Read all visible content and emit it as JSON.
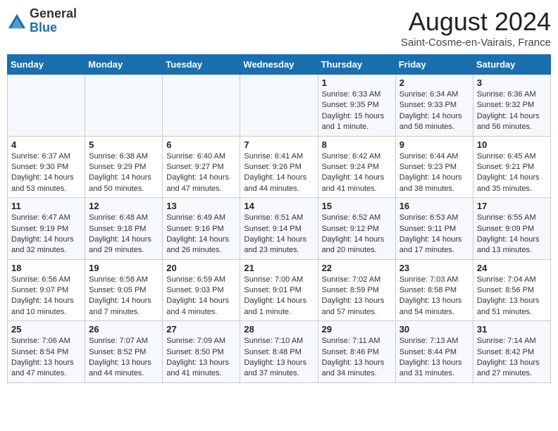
{
  "header": {
    "logo_general": "General",
    "logo_blue": "Blue",
    "month_year": "August 2024",
    "location": "Saint-Cosme-en-Vairais, France"
  },
  "days_of_week": [
    "Sunday",
    "Monday",
    "Tuesday",
    "Wednesday",
    "Thursday",
    "Friday",
    "Saturday"
  ],
  "weeks": [
    [
      {
        "num": "",
        "info": ""
      },
      {
        "num": "",
        "info": ""
      },
      {
        "num": "",
        "info": ""
      },
      {
        "num": "",
        "info": ""
      },
      {
        "num": "1",
        "info": "Sunrise: 6:33 AM\nSunset: 9:35 PM\nDaylight: 15 hours and 1 minute."
      },
      {
        "num": "2",
        "info": "Sunrise: 6:34 AM\nSunset: 9:33 PM\nDaylight: 14 hours and 58 minutes."
      },
      {
        "num": "3",
        "info": "Sunrise: 6:36 AM\nSunset: 9:32 PM\nDaylight: 14 hours and 56 minutes."
      }
    ],
    [
      {
        "num": "4",
        "info": "Sunrise: 6:37 AM\nSunset: 9:30 PM\nDaylight: 14 hours and 53 minutes."
      },
      {
        "num": "5",
        "info": "Sunrise: 6:38 AM\nSunset: 9:29 PM\nDaylight: 14 hours and 50 minutes."
      },
      {
        "num": "6",
        "info": "Sunrise: 6:40 AM\nSunset: 9:27 PM\nDaylight: 14 hours and 47 minutes."
      },
      {
        "num": "7",
        "info": "Sunrise: 6:41 AM\nSunset: 9:26 PM\nDaylight: 14 hours and 44 minutes."
      },
      {
        "num": "8",
        "info": "Sunrise: 6:42 AM\nSunset: 9:24 PM\nDaylight: 14 hours and 41 minutes."
      },
      {
        "num": "9",
        "info": "Sunrise: 6:44 AM\nSunset: 9:23 PM\nDaylight: 14 hours and 38 minutes."
      },
      {
        "num": "10",
        "info": "Sunrise: 6:45 AM\nSunset: 9:21 PM\nDaylight: 14 hours and 35 minutes."
      }
    ],
    [
      {
        "num": "11",
        "info": "Sunrise: 6:47 AM\nSunset: 9:19 PM\nDaylight: 14 hours and 32 minutes."
      },
      {
        "num": "12",
        "info": "Sunrise: 6:48 AM\nSunset: 9:18 PM\nDaylight: 14 hours and 29 minutes."
      },
      {
        "num": "13",
        "info": "Sunrise: 6:49 AM\nSunset: 9:16 PM\nDaylight: 14 hours and 26 minutes."
      },
      {
        "num": "14",
        "info": "Sunrise: 6:51 AM\nSunset: 9:14 PM\nDaylight: 14 hours and 23 minutes."
      },
      {
        "num": "15",
        "info": "Sunrise: 6:52 AM\nSunset: 9:12 PM\nDaylight: 14 hours and 20 minutes."
      },
      {
        "num": "16",
        "info": "Sunrise: 6:53 AM\nSunset: 9:11 PM\nDaylight: 14 hours and 17 minutes."
      },
      {
        "num": "17",
        "info": "Sunrise: 6:55 AM\nSunset: 9:09 PM\nDaylight: 14 hours and 13 minutes."
      }
    ],
    [
      {
        "num": "18",
        "info": "Sunrise: 6:56 AM\nSunset: 9:07 PM\nDaylight: 14 hours and 10 minutes."
      },
      {
        "num": "19",
        "info": "Sunrise: 6:58 AM\nSunset: 9:05 PM\nDaylight: 14 hours and 7 minutes."
      },
      {
        "num": "20",
        "info": "Sunrise: 6:59 AM\nSunset: 9:03 PM\nDaylight: 14 hours and 4 minutes."
      },
      {
        "num": "21",
        "info": "Sunrise: 7:00 AM\nSunset: 9:01 PM\nDaylight: 14 hours and 1 minute."
      },
      {
        "num": "22",
        "info": "Sunrise: 7:02 AM\nSunset: 8:59 PM\nDaylight: 13 hours and 57 minutes."
      },
      {
        "num": "23",
        "info": "Sunrise: 7:03 AM\nSunset: 8:58 PM\nDaylight: 13 hours and 54 minutes."
      },
      {
        "num": "24",
        "info": "Sunrise: 7:04 AM\nSunset: 8:56 PM\nDaylight: 13 hours and 51 minutes."
      }
    ],
    [
      {
        "num": "25",
        "info": "Sunrise: 7:06 AM\nSunset: 8:54 PM\nDaylight: 13 hours and 47 minutes."
      },
      {
        "num": "26",
        "info": "Sunrise: 7:07 AM\nSunset: 8:52 PM\nDaylight: 13 hours and 44 minutes."
      },
      {
        "num": "27",
        "info": "Sunrise: 7:09 AM\nSunset: 8:50 PM\nDaylight: 13 hours and 41 minutes."
      },
      {
        "num": "28",
        "info": "Sunrise: 7:10 AM\nSunset: 8:48 PM\nDaylight: 13 hours and 37 minutes."
      },
      {
        "num": "29",
        "info": "Sunrise: 7:11 AM\nSunset: 8:46 PM\nDaylight: 13 hours and 34 minutes."
      },
      {
        "num": "30",
        "info": "Sunrise: 7:13 AM\nSunset: 8:44 PM\nDaylight: 13 hours and 31 minutes."
      },
      {
        "num": "31",
        "info": "Sunrise: 7:14 AM\nSunset: 8:42 PM\nDaylight: 13 hours and 27 minutes."
      }
    ]
  ]
}
